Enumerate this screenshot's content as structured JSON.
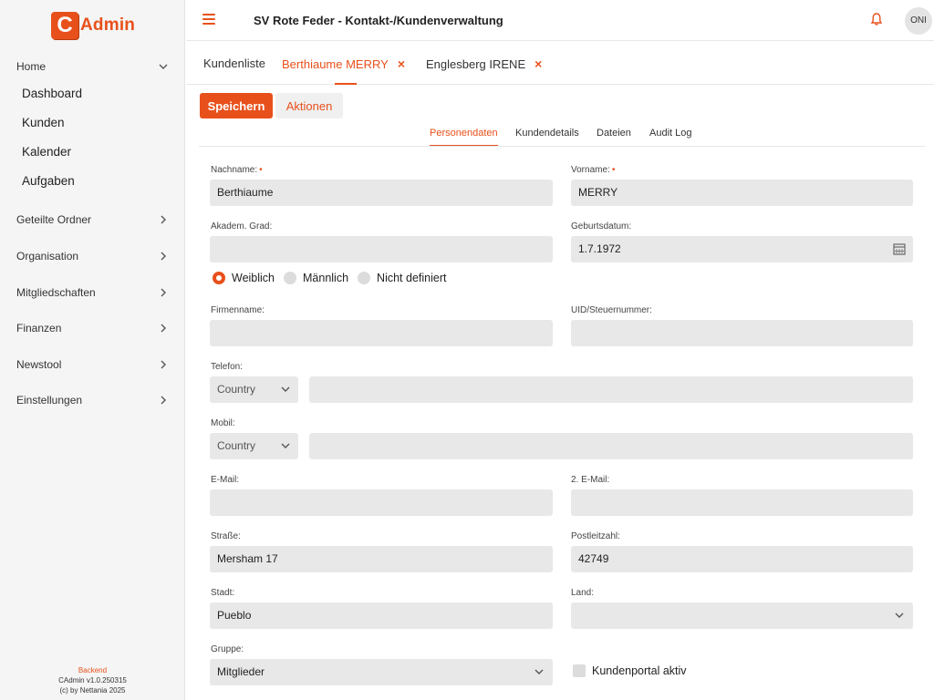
{
  "sidebar": {
    "logo_letter": "C",
    "logo_text": "Admin",
    "home_label": "Home",
    "sub_items": [
      "Dashboard",
      "Kunden",
      "Kalender",
      "Aufgaben"
    ],
    "items": [
      "Geteilte Ordner",
      "Organisation",
      "Mitgliedschaften",
      "Finanzen",
      "Newstool",
      "Einstellungen"
    ],
    "footer": {
      "env": "Backend",
      "version": "CAdmin v1.0.250315",
      "copyright": "(c) by Nettania 2025"
    }
  },
  "header": {
    "title": "SV Rote Feder - Kontakt-/Kundenverwaltung",
    "avatar_initials": "ONI"
  },
  "tabs": [
    {
      "label": "Kundenliste"
    },
    {
      "label": "Berthiaume MERRY"
    },
    {
      "label": "Englesberg IRENE"
    }
  ],
  "toolbar": {
    "save_label": "Speichern",
    "actions_label": "Aktionen"
  },
  "subtabs": [
    "Personendaten",
    "Kundendetails",
    "Dateien",
    "Audit Log"
  ],
  "form": {
    "nachname": {
      "label": "Nachname:",
      "value": "Berthiaume",
      "required_mark": "•"
    },
    "vorname": {
      "label": "Vorname:",
      "value": "MERRY",
      "required_mark": "•"
    },
    "akadem_grad": {
      "label": "Akadem. Grad:",
      "value": ""
    },
    "geburtsdatum": {
      "label": "Geburtsdatum:",
      "value": "1.7.1972"
    },
    "gender": {
      "options": [
        "Weiblich",
        "Männlich",
        "Nicht definiert"
      ],
      "selected": "Weiblich"
    },
    "firmenname": {
      "label": "Firmenname:",
      "value": ""
    },
    "uid": {
      "label": "UID/Steuernummer:",
      "value": ""
    },
    "telefon": {
      "label": "Telefon:",
      "country": "Country",
      "value": ""
    },
    "mobil": {
      "label": "Mobil:",
      "country": "Country",
      "value": ""
    },
    "email": {
      "label": "E-Mail:",
      "value": ""
    },
    "email2": {
      "label": "2. E-Mail:",
      "value": ""
    },
    "strasse": {
      "label": "Straße:",
      "value": "Mersham 17"
    },
    "plz": {
      "label": "Postleitzahl:",
      "value": "42749"
    },
    "stadt": {
      "label": "Stadt:",
      "value": "Pueblo"
    },
    "land": {
      "label": "Land:",
      "value": ""
    },
    "gruppe": {
      "label": "Gruppe:",
      "value": "Mitglieder"
    },
    "kundenportal": {
      "label": "Kundenportal aktiv",
      "checked": false
    }
  },
  "colors": {
    "accent": "#e8501b",
    "field_bg": "#e8e8e8",
    "sidebar_bg": "#f5f5f5"
  }
}
